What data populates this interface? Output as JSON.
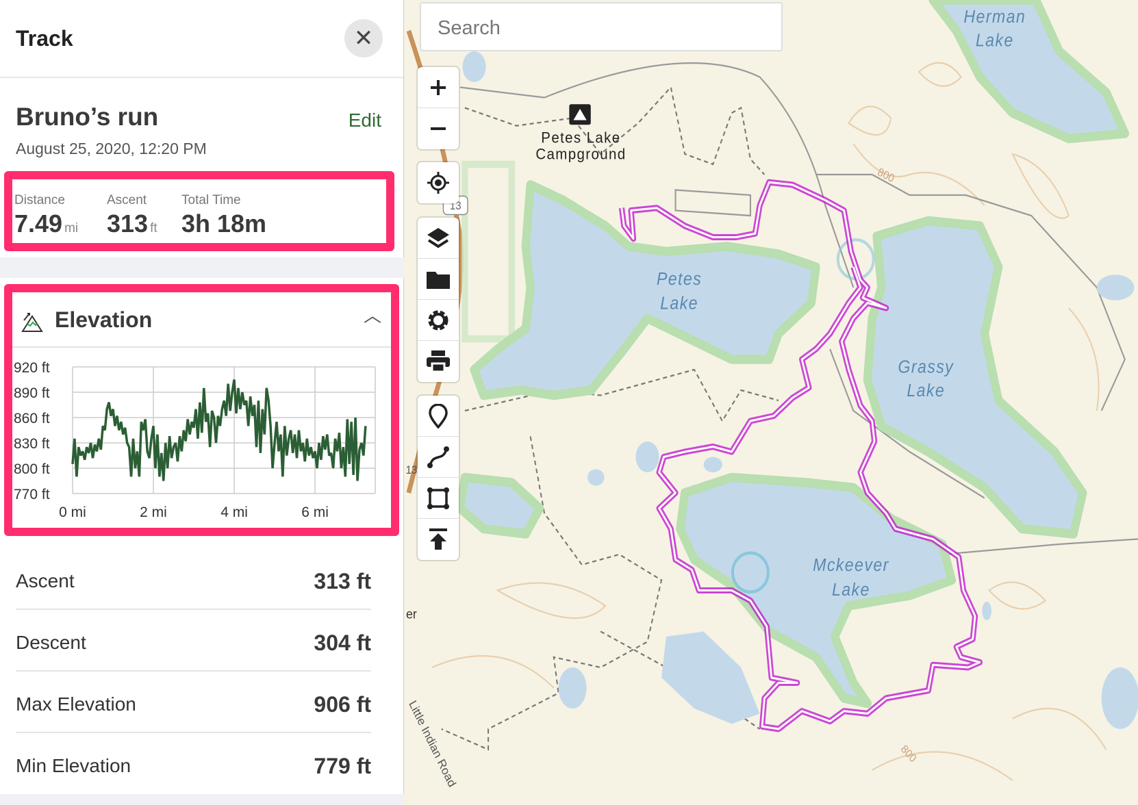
{
  "panel": {
    "title": "Track",
    "close_icon": "close-icon"
  },
  "track": {
    "name": "Bruno’s run",
    "edit_label": "Edit",
    "date": "August 25, 2020, 12:20 PM"
  },
  "summary": [
    {
      "label": "Distance",
      "value": "7.49",
      "unit": "mi"
    },
    {
      "label": "Ascent",
      "value": "313",
      "unit": "ft"
    },
    {
      "label": "Total Time",
      "value": "3h 18m",
      "unit": ""
    }
  ],
  "highlight_color": "#ff2d6e",
  "elevation": {
    "title": "Elevation",
    "icon": "mountain-elevation-icon",
    "collapse_icon": "chevron-up-icon"
  },
  "chart_data": {
    "type": "line",
    "xlabel": "",
    "ylabel": "",
    "xlim": [
      0,
      7.49
    ],
    "ylim": [
      770,
      920
    ],
    "xticks": [
      "0 mi",
      "2 mi",
      "4 mi",
      "6 mi"
    ],
    "yticks": [
      "920 ft",
      "890 ft",
      "860 ft",
      "830 ft",
      "800 ft",
      "770 ft"
    ],
    "grid": true,
    "color": "#2b5e34",
    "x": [
      0,
      0.05,
      0.1,
      0.15,
      0.2,
      0.25,
      0.3,
      0.35,
      0.4,
      0.45,
      0.5,
      0.55,
      0.6,
      0.65,
      0.7,
      0.75,
      0.8,
      0.85,
      0.9,
      0.95,
      1.0,
      1.05,
      1.1,
      1.15,
      1.2,
      1.25,
      1.3,
      1.35,
      1.4,
      1.45,
      1.5,
      1.55,
      1.6,
      1.65,
      1.7,
      1.75,
      1.8,
      1.85,
      1.9,
      1.95,
      2.0,
      2.05,
      2.1,
      2.15,
      2.2,
      2.25,
      2.3,
      2.35,
      2.4,
      2.45,
      2.5,
      2.55,
      2.6,
      2.65,
      2.7,
      2.75,
      2.8,
      2.85,
      2.9,
      2.95,
      3.0,
      3.05,
      3.1,
      3.15,
      3.2,
      3.25,
      3.3,
      3.35,
      3.4,
      3.45,
      3.5,
      3.55,
      3.6,
      3.65,
      3.7,
      3.75,
      3.8,
      3.85,
      3.9,
      3.95,
      4.0,
      4.05,
      4.1,
      4.15,
      4.2,
      4.25,
      4.3,
      4.35,
      4.4,
      4.45,
      4.5,
      4.55,
      4.6,
      4.65,
      4.7,
      4.75,
      4.8,
      4.85,
      4.9,
      4.95,
      5.0,
      5.05,
      5.1,
      5.15,
      5.2,
      5.25,
      5.3,
      5.35,
      5.4,
      5.45,
      5.5,
      5.55,
      5.6,
      5.65,
      5.7,
      5.75,
      5.8,
      5.85,
      5.9,
      5.95,
      6.0,
      6.05,
      6.1,
      6.15,
      6.2,
      6.25,
      6.3,
      6.35,
      6.4,
      6.45,
      6.5,
      6.55,
      6.6,
      6.65,
      6.7,
      6.75,
      6.8,
      6.85,
      6.9,
      6.95,
      7.0,
      7.05,
      7.1,
      7.15,
      7.2,
      7.25,
      7.3,
      7.35,
      7.4,
      7.49
    ],
    "y": [
      805,
      835,
      790,
      825,
      815,
      820,
      810,
      825,
      818,
      830,
      812,
      828,
      820,
      835,
      822,
      850,
      845,
      870,
      878,
      862,
      870,
      850,
      862,
      845,
      855,
      840,
      848,
      830,
      825,
      790,
      835,
      800,
      820,
      790,
      855,
      845,
      858,
      820,
      812,
      835,
      850,
      800,
      840,
      790,
      818,
      785,
      830,
      800,
      838,
      812,
      825,
      830,
      808,
      838,
      820,
      845,
      832,
      858,
      840,
      855,
      848,
      870,
      835,
      878,
      842,
      895,
      855,
      865,
      825,
      868,
      860,
      830,
      862,
      850,
      870,
      880,
      862,
      900,
      868,
      890,
      905,
      865,
      895,
      870,
      890,
      875,
      880,
      850,
      885,
      862,
      875,
      825,
      880,
      818,
      870,
      840,
      895,
      880,
      850,
      800,
      830,
      855,
      820,
      840,
      790,
      850,
      815,
      835,
      845,
      818,
      840,
      812,
      845,
      820,
      830,
      808,
      835,
      815,
      825,
      812,
      820,
      800,
      830,
      810,
      838,
      822,
      840,
      815,
      818,
      800,
      835,
      820,
      842,
      800,
      825,
      790,
      858,
      805,
      855,
      792,
      860,
      785,
      822,
      830,
      815,
      850
    ]
  },
  "stats": [
    {
      "label": "Ascent",
      "value": "313 ft"
    },
    {
      "label": "Descent",
      "value": "304 ft"
    },
    {
      "label": "Max Elevation",
      "value": "906 ft"
    },
    {
      "label": "Min Elevation",
      "value": "779 ft"
    }
  ],
  "map": {
    "search_placeholder": "Search",
    "labels": {
      "campground": "Petes Lake",
      "campground2": "Campground",
      "petes1": "Petes",
      "petes2": "Lake",
      "grassy1": "Grassy",
      "grassy2": "Lake",
      "herman1": "Herman",
      "herman2": "Lake",
      "mckeever1": "Mckeever",
      "mckeever2": "Lake",
      "road": "Little Indian Road",
      "contour1": "800",
      "contour2": "800",
      "shield1": "13",
      "shield2": "13",
      "partial1": "er"
    },
    "track_color": "#c21ccf",
    "water_color": "#c3d9ea",
    "toolbar": [
      "zoom-in",
      "zoom-out",
      "locate",
      "layers",
      "folder",
      "settings",
      "print",
      "marker",
      "route",
      "area",
      "upload"
    ]
  }
}
